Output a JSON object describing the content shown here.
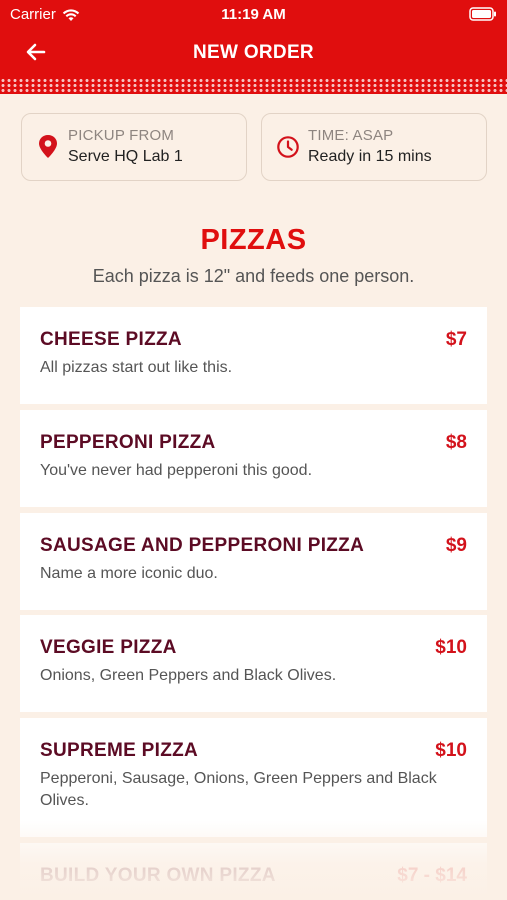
{
  "status": {
    "carrier": "Carrier",
    "time": "11:19 AM"
  },
  "nav": {
    "title": "NEW ORDER"
  },
  "pickup": {
    "label": "PICKUP FROM",
    "value": "Serve HQ Lab 1"
  },
  "time_card": {
    "label": "TIME: ASAP",
    "value": "Ready in 15 mins"
  },
  "section": {
    "title": "PIZZAS",
    "subtitle": "Each pizza is 12\" and feeds one person."
  },
  "items": [
    {
      "name": "CHEESE PIZZA",
      "price": "$7",
      "desc": "All pizzas start out like this."
    },
    {
      "name": "PEPPERONI PIZZA",
      "price": "$8",
      "desc": "You've never had pepperoni this good."
    },
    {
      "name": "SAUSAGE AND PEPPERONI PIZZA",
      "price": "$9",
      "desc": "Name a more iconic duo."
    },
    {
      "name": "VEGGIE PIZZA",
      "price": "$10",
      "desc": "Onions, Green Peppers and Black Olives."
    },
    {
      "name": "SUPREME PIZZA",
      "price": "$10",
      "desc": "Pepperoni, Sausage, Onions, Green Peppers and Black Olives."
    },
    {
      "name": "BUILD YOUR OWN PIZZA",
      "price": "$7 - $14",
      "desc": ""
    }
  ],
  "colors": {
    "brand_red": "#e00e0e",
    "item_name": "#5c0b24",
    "price": "#d3121b",
    "background": "#fbf0e6"
  },
  "icons": {
    "back": "arrow-left-icon",
    "pickup": "location-pin-icon",
    "time": "clock-icon"
  }
}
